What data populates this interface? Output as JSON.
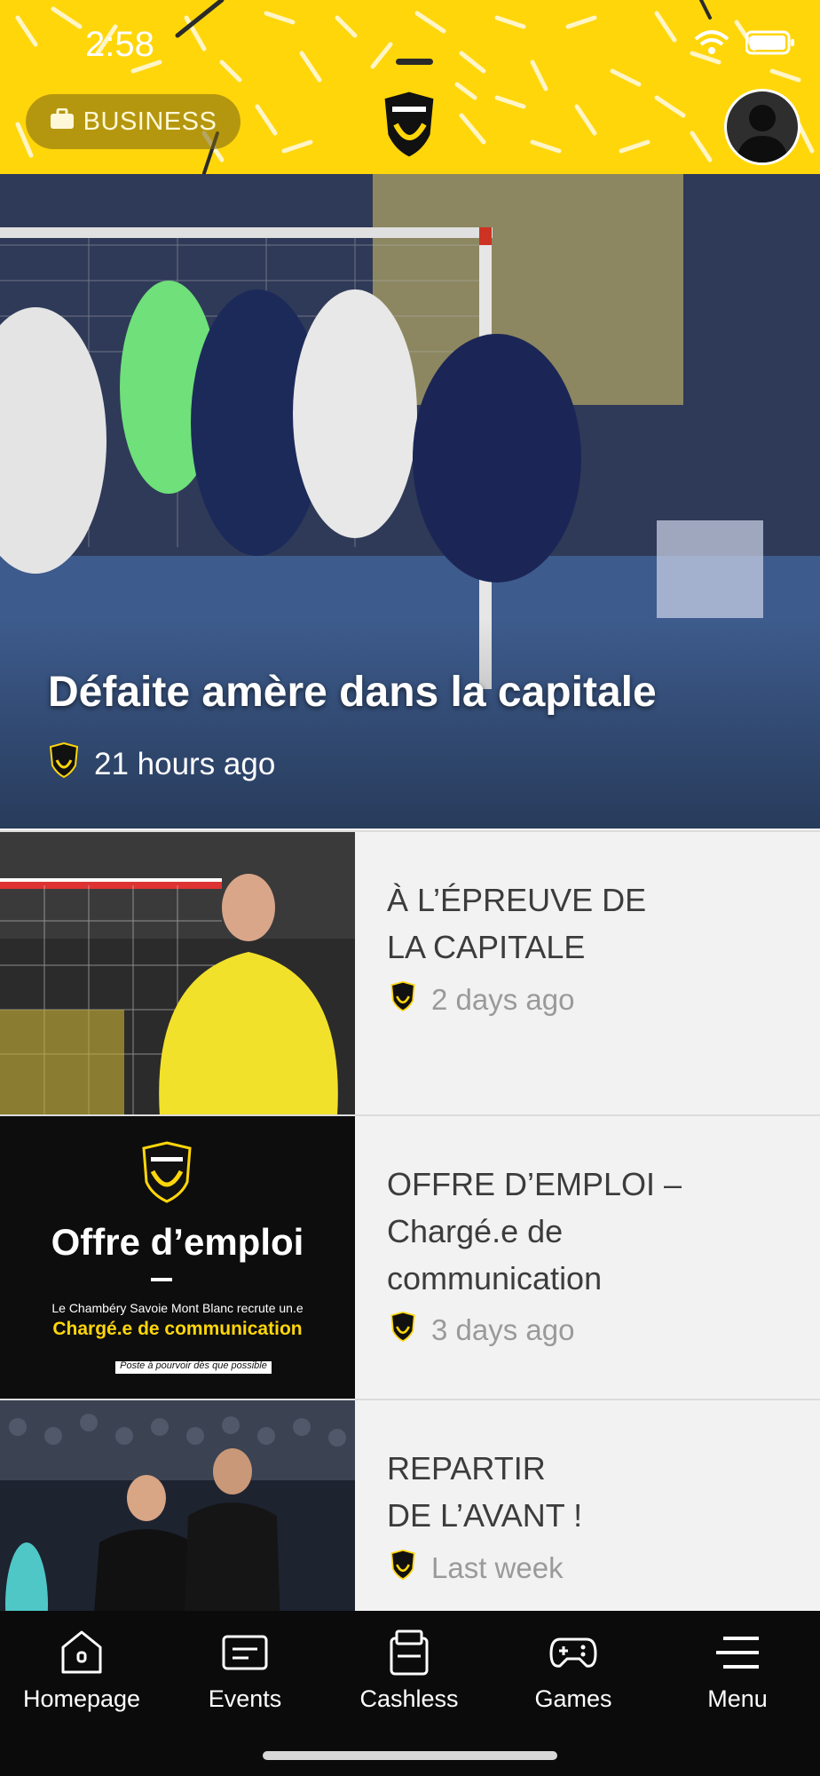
{
  "status_bar": {
    "time": "2:58"
  },
  "header": {
    "business_label": "BUSINESS",
    "colors": {
      "yellow": "#ffd60a",
      "dark": "#0b0b0b"
    }
  },
  "hero": {
    "title": "Défaite amère dans la capitale",
    "time": "21 hours ago"
  },
  "news": [
    {
      "title_line1": "À L’ÉPREUVE DE",
      "title_line2": "LA CAPITALE",
      "time": "2 days ago",
      "thumb": "goalkeeper-photo"
    },
    {
      "title_line1": "OFFRE D’EMPLOI –",
      "title_line2": "Chargé.e de",
      "title_line3": "communication",
      "time": "3 days ago",
      "thumb": "job-offer-graphic",
      "thumb_text": {
        "heading": "Offre d’emploi",
        "subtitle": "Le Chambéry Savoie Mont Blanc recrute un.e",
        "role": "Chargé.e de communication",
        "note": "Poste à pourvoir dès que possible"
      }
    },
    {
      "title_line1": "REPARTIR",
      "title_line2": "DE L’AVANT !",
      "time": "Last week",
      "thumb": "players-photo"
    }
  ],
  "nav": {
    "items": [
      {
        "label": "Homepage",
        "icon": "home-icon"
      },
      {
        "label": "Events",
        "icon": "ticket-icon"
      },
      {
        "label": "Cashless",
        "icon": "card-icon"
      },
      {
        "label": "Games",
        "icon": "gamepad-icon"
      },
      {
        "label": "Menu",
        "icon": "menu-icon"
      }
    ]
  }
}
